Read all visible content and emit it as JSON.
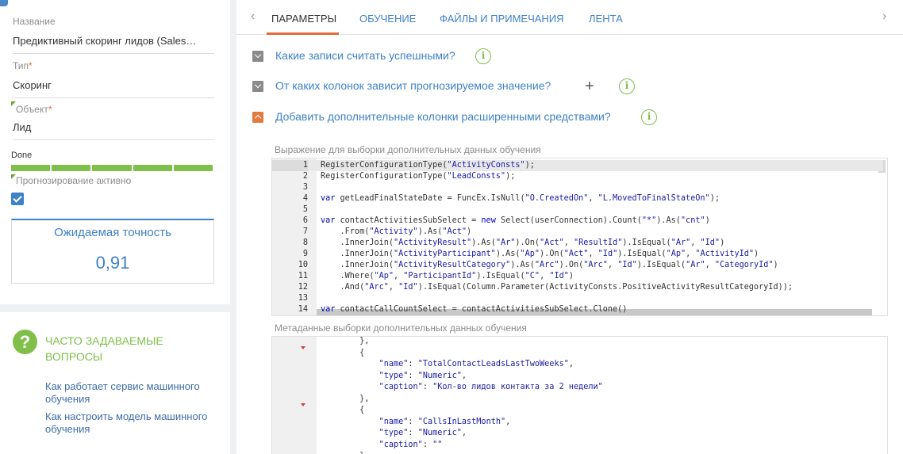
{
  "left": {
    "name_label": "Название",
    "name_value": "Предиктивный скоринг лидов (Sales…",
    "type_label": "Тип",
    "type_value": "Скоринг",
    "object_label": "Объект",
    "object_value": "Лид",
    "required_mark": "*",
    "stage_label": "Done",
    "prediction_label": "Прогнозирование активно",
    "prediction_checked": true,
    "accuracy_title": "Ожидаемая точность",
    "accuracy_value": "0,91"
  },
  "faq": {
    "icon": "question-icon",
    "icon_glyph": "?",
    "title": "ЧАСТО ЗАДАВАЕМЫЕ ВОПРОСЫ",
    "links": [
      "Как работает сервис машинного обучения",
      "Как настроить модель машинного обучения"
    ]
  },
  "tabs": {
    "items": [
      "ПАРАМЕТРЫ",
      "ОБУЧЕНИЕ",
      "ФАЙЛЫ И ПРИМЕЧАНИЯ",
      "ЛЕНТА"
    ],
    "active": "ПАРАМЕТРЫ",
    "prev_glyph": "‹",
    "next_glyph": "›"
  },
  "sections": [
    {
      "title": "Какие записи считать успешными?",
      "expanded": false
    },
    {
      "title": "От каких колонок зависит прогнозируемое значение?",
      "expanded": false
    },
    {
      "title": "Добавить дополнительные колонки расширенными средствами?",
      "expanded": true
    }
  ],
  "info_glyph": "i",
  "plus_glyph": "+",
  "editor1": {
    "label": "Выражение для выборки дополнительных данных обучения",
    "current_line": 1,
    "lines": [
      "RegisterConfigurationType(\"ActivityConsts\");",
      "RegisterConfigurationType(\"LeadConsts\");",
      "",
      "var getLeadFinalStateDate = FuncEx.IsNull(\"O.CreatedOn\", \"L.MovedToFinalStateOn\");",
      "",
      "var contactActivitiesSubSelect = new Select(userConnection).Count(\"*\").As(\"cnt\")",
      "    .From(\"Activity\").As(\"Act\")",
      "    .InnerJoin(\"ActivityResult\").As(\"Ar\").On(\"Act\", \"ResultId\").IsEqual(\"Ar\", \"Id\")",
      "    .InnerJoin(\"ActivityParticipant\").As(\"Ap\").On(\"Act\", \"Id\").IsEqual(\"Ap\", \"ActivityId\")",
      "    .InnerJoin(\"ActivityResultCategory\").As(\"Arc\").On(\"Arc\", \"Id\").IsEqual(\"Ar\", \"CategoryId\")",
      "    .Where(\"Ap\", \"ParticipantId\").IsEqual(\"C\", \"Id\")",
      "    .And(\"Arc\", \"Id\").IsEqual(Column.Parameter(ActivityConsts.PositiveActivityResultCategoryId));",
      "",
      "var contactCallCountSelect = contactActivitiesSubSelect.Clone()"
    ]
  },
  "editor2": {
    "label": "Метаданные выборки дополнительных данных обучения",
    "lines": [
      "        },",
      "        {",
      "            \"name\": \"TotalContactLeadsLastTwoWeeks\",",
      "            \"type\": \"Numeric\",",
      "            \"caption\": \"Кол-во лидов контакта за 2 недели\"",
      "        },",
      "        {",
      "            \"name\": \"CallsInLastMonth\",",
      "            \"type\": \"Numeric\",",
      "            \"caption\": \"\"",
      "        },"
    ]
  },
  "colors": {
    "accent_blue": "#3e82c8",
    "accent_green": "#7fbf4a",
    "accent_orange": "#e06c3c"
  }
}
